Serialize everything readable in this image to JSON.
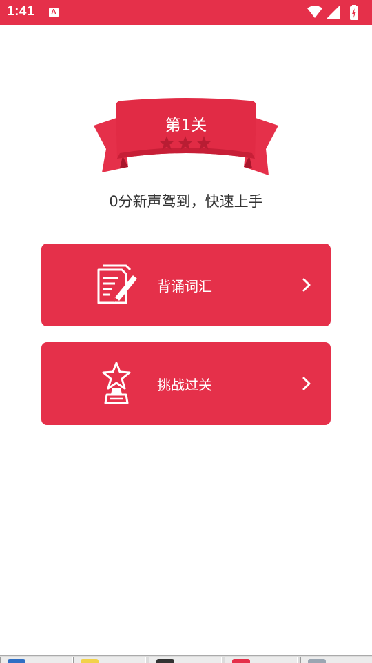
{
  "status_bar": {
    "time": "1:41",
    "notification_icon": "A"
  },
  "level": {
    "title": "第1关",
    "stars_total": 3,
    "stars_earned": 0
  },
  "subtitle": "0分新声驾到，快速上手",
  "actions": [
    {
      "label": "背诵词汇",
      "icon": "notepad-pen-icon"
    },
    {
      "label": "挑战过关",
      "icon": "trophy-star-icon"
    }
  ],
  "colors": {
    "primary": "#e5304a",
    "ribbon_dark": "#c21f37",
    "star_inactive": "#b81d33",
    "text": "#333333",
    "background": "#ffffff"
  },
  "taskbar": {
    "tab_colors": [
      "#2f6fc4",
      "#f2d24a",
      "#333333",
      "#e5304a",
      "#9aa6b2"
    ]
  }
}
